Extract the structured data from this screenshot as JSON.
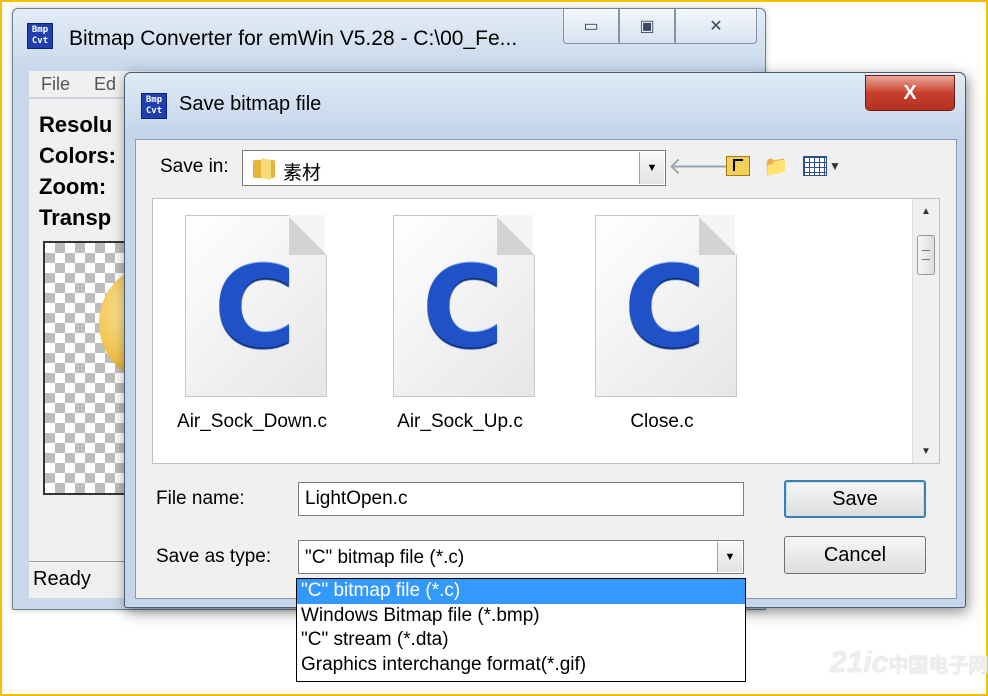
{
  "main_window": {
    "icon_text": "Bmp Cvt",
    "title": "Bitmap Converter for emWin V5.28 - C:\\00_Fe...",
    "menu": [
      "File",
      "Ed"
    ],
    "info_lines": [
      "Resolu",
      "Colors:",
      "Zoom:",
      "Transp"
    ],
    "status": "Ready"
  },
  "dialog": {
    "title": "Save bitmap file",
    "close_glyph": "X",
    "save_in_label": "Save in:",
    "save_in_value": "素材",
    "files": [
      {
        "name": "Air_Sock_Down.c",
        "glyph": "C"
      },
      {
        "name": "Air_Sock_Up.c",
        "glyph": "C"
      },
      {
        "name": "Close.c",
        "glyph": "C"
      }
    ],
    "file_name_label": "File name:",
    "file_name_value": "LightOpen.c",
    "save_as_label": "Save as type:",
    "save_as_value": "\"C\" bitmap file (*.c)",
    "save_button": "Save",
    "cancel_button": "Cancel",
    "type_options": [
      "\"C\" bitmap file (*.c)",
      "Windows Bitmap file (*.bmp)",
      "\"C\" stream (*.dta)",
      "Graphics interchange format(*.gif)"
    ],
    "selected_type_index": 0
  },
  "watermark": {
    "main": "21ic",
    "sub": "中国电子网"
  },
  "colors": {
    "frame": "#f5c000",
    "selection": "#3399ff",
    "file_icon": "#1f52c6",
    "close_button": "#c9412d"
  }
}
